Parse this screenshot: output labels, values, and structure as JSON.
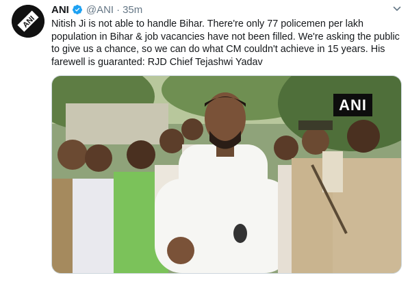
{
  "tweet": {
    "author_name": "ANI",
    "handle": "@ANI",
    "separator": "·",
    "time": "35m",
    "text": "Nitish Ji is not able to handle Bihar. There're only 77 policemen per lakh population in Bihar & job vacancies have not been filled. We're asking the public to give us a chance, so we can do what CM couldn't achieve in 15 years. His farewell is guaranted: RJD Chief Tejashwi Yadav",
    "avatar_logo_text": "ANI",
    "media_watermark": "ANI"
  },
  "colors": {
    "verified_blue": "#1da1f2",
    "secondary_text": "#657786",
    "primary_text": "#14171a"
  },
  "icons": {
    "verified": "verified-badge-icon",
    "menu": "chevron-down-icon"
  }
}
